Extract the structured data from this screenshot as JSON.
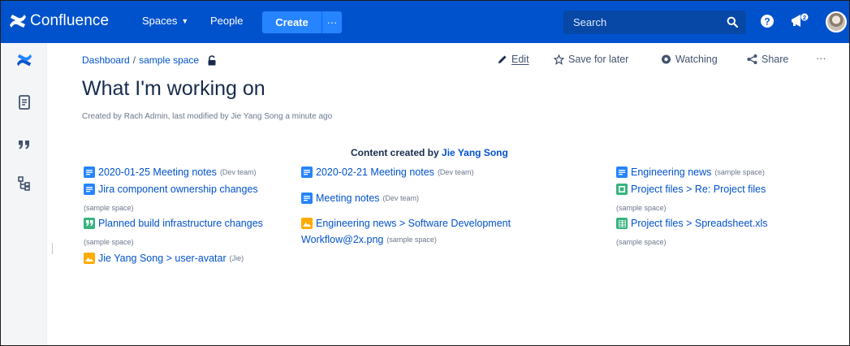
{
  "nav": {
    "logo_text": "Confluence",
    "spaces_label": "Spaces",
    "people_label": "People",
    "create_label": "Create",
    "more_label": "···",
    "search_placeholder": "Search"
  },
  "breadcrumb": {
    "dashboard": "Dashboard",
    "separator": "/",
    "space": "sample space"
  },
  "page": {
    "title": "What I'm working on",
    "byline": "Created by Rach Admin, last modified by Jie Yang Song a minute ago"
  },
  "actions": {
    "edit": "Edit",
    "save_for_later": "Save for later",
    "watching": "Watching",
    "share": "Share",
    "more": "···"
  },
  "content": {
    "heading_prefix": "Content created by",
    "heading_user": "Jie Yang Song",
    "items": [
      {
        "icon": "page-icon",
        "title": "2020-01-25 Meeting notes",
        "space": "(Dev team)"
      },
      {
        "icon": "page-icon",
        "title": "Jira component ownership changes",
        "space": "(sample space)"
      },
      {
        "icon": "blog-icon",
        "title": "Planned build infrastructure changes",
        "space": "(sample space)"
      },
      {
        "icon": "image-icon",
        "title": "Jie Yang Song > user-avatar",
        "space": "(Jie)"
      },
      {
        "icon": "page-icon",
        "title": "2020-02-21 Meeting notes",
        "space": "(Dev team)"
      },
      {
        "icon": "page-icon",
        "title": "Meeting notes",
        "space": "(Dev team)"
      },
      {
        "icon": "image-icon",
        "title": "Engineering news > Software Development",
        "title2": "Workflow@2x.png",
        "space": "(sample space)"
      },
      {
        "icon": "page-icon",
        "title": "Engineering news",
        "space": "(sample space)"
      },
      {
        "icon": "file-icon",
        "title": "Project files > Re: Project files",
        "space": "(sample space)"
      },
      {
        "icon": "spreadsheet-icon",
        "title": "Project files > Spreadsheet.xls",
        "space": "(sample space)"
      }
    ]
  },
  "colors": {
    "nav_bg": "#0052cc",
    "create_bg": "#2684ff",
    "link": "#0052cc"
  }
}
